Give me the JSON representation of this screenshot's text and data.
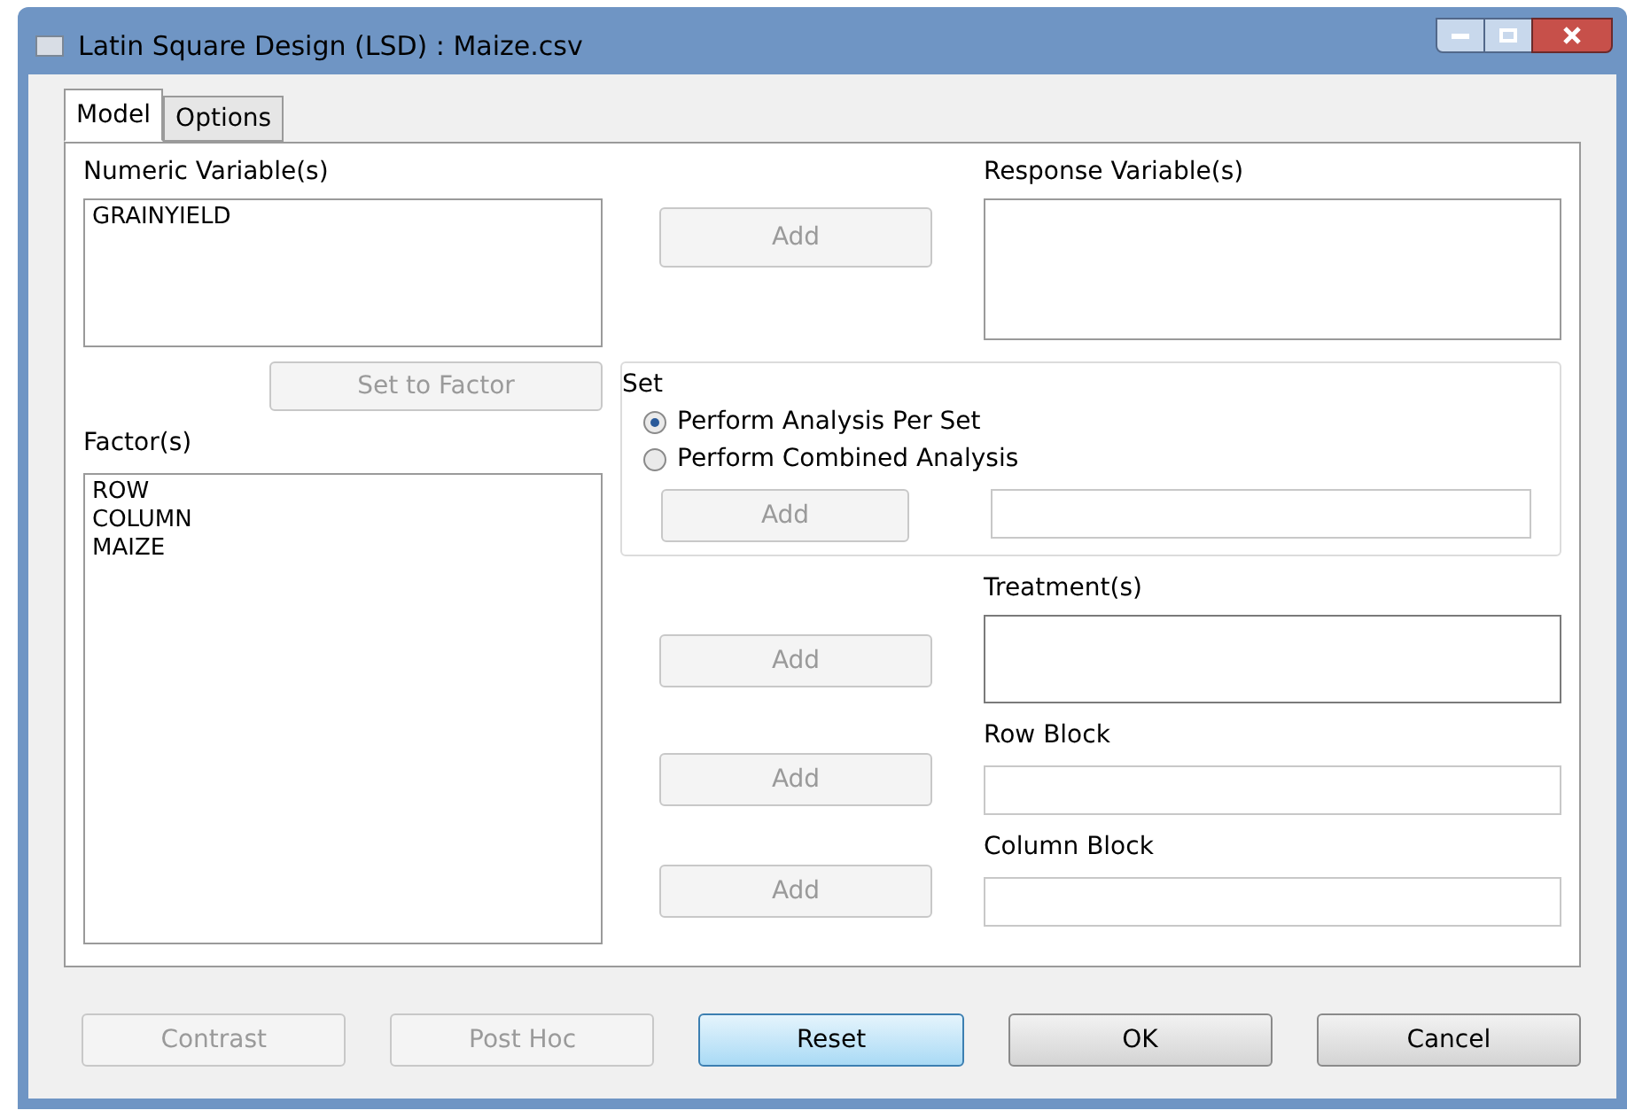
{
  "window": {
    "title": "Latin Square Design (LSD) : Maize.csv"
  },
  "tabs": [
    {
      "label": "Model",
      "selected": true
    },
    {
      "label": "Options",
      "selected": false
    }
  ],
  "numeric_variables": {
    "label": "Numeric Variable(s)",
    "items": [
      "GRAINYIELD"
    ]
  },
  "set_to_factor_button": {
    "label": "Set to Factor",
    "disabled": true
  },
  "factors": {
    "label": "Factor(s)",
    "items": [
      "ROW",
      "COLUMN",
      "MAIZE"
    ]
  },
  "response": {
    "label": "Response Variable(s)",
    "add": {
      "label": "Add",
      "disabled": true
    }
  },
  "set_group": {
    "title": "Set",
    "options": [
      {
        "label": "Perform Analysis Per Set",
        "selected": true
      },
      {
        "label": "Perform Combined Analysis",
        "selected": false
      }
    ],
    "add": {
      "label": "Add",
      "disabled": true
    }
  },
  "targets": [
    {
      "label": "Treatment(s)",
      "kind": "list",
      "add": {
        "label": "Add",
        "disabled": true
      }
    },
    {
      "label": "Row Block",
      "kind": "field",
      "add": {
        "label": "Add",
        "disabled": true
      }
    },
    {
      "label": "Column Block",
      "kind": "field",
      "add": {
        "label": "Add",
        "disabled": true
      }
    }
  ],
  "buttons": [
    {
      "label": "Contrast",
      "disabled": true,
      "focused": false
    },
    {
      "label": "Post Hoc",
      "disabled": true,
      "focused": false
    },
    {
      "label": "Reset",
      "disabled": false,
      "focused": true
    },
    {
      "label": "OK",
      "disabled": false,
      "focused": false
    },
    {
      "label": "Cancel",
      "disabled": false,
      "focused": false
    }
  ]
}
